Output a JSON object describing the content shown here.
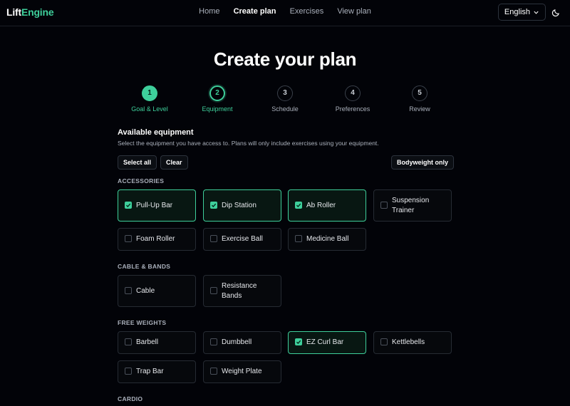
{
  "header": {
    "logo_part1": "Lift",
    "logo_part2": "Engine",
    "nav": [
      "Home",
      "Create plan",
      "Exercises",
      "View plan"
    ],
    "active_nav": "Create plan",
    "language": "English"
  },
  "page": {
    "title": "Create your plan"
  },
  "steps": [
    {
      "number": "1",
      "label": "Goal & Level",
      "state": "done"
    },
    {
      "number": "2",
      "label": "Equipment",
      "state": "current"
    },
    {
      "number": "3",
      "label": "Schedule",
      "state": "pending"
    },
    {
      "number": "4",
      "label": "Preferences",
      "state": "pending"
    },
    {
      "number": "5",
      "label": "Review",
      "state": "pending"
    }
  ],
  "equipment": {
    "title": "Available equipment",
    "description": "Select the equipment you have access to. Plans will only include exercises using your equipment.",
    "select_all": "Select all",
    "clear": "Clear",
    "bodyweight_only": "Bodyweight only",
    "categories": [
      {
        "name": "ACCESSORIES",
        "items": [
          {
            "name": "Pull-Up Bar",
            "checked": true
          },
          {
            "name": "Dip Station",
            "checked": true
          },
          {
            "name": "Ab Roller",
            "checked": true
          },
          {
            "name": "Suspension Trainer",
            "checked": false
          },
          {
            "name": "Foam Roller",
            "checked": false
          },
          {
            "name": "Exercise Ball",
            "checked": false
          },
          {
            "name": "Medicine Ball",
            "checked": false
          }
        ]
      },
      {
        "name": "CABLE & BANDS",
        "items": [
          {
            "name": "Cable",
            "checked": false
          },
          {
            "name": "Resistance Bands",
            "checked": false
          }
        ]
      },
      {
        "name": "FREE WEIGHTS",
        "items": [
          {
            "name": "Barbell",
            "checked": false
          },
          {
            "name": "Dumbbell",
            "checked": false
          },
          {
            "name": "EZ Curl Bar",
            "checked": true
          },
          {
            "name": "Kettlebells",
            "checked": false
          },
          {
            "name": "Trap Bar",
            "checked": false
          },
          {
            "name": "Weight Plate",
            "checked": false
          }
        ]
      },
      {
        "name": "CARDIO",
        "items": []
      }
    ]
  },
  "colors": {
    "accent": "#3ecf9b",
    "background": "#020308"
  },
  "icons": {
    "language_dropdown": "chevron-down-icon",
    "theme_toggle": "moon-icon",
    "checkbox_checked": "check-icon"
  }
}
